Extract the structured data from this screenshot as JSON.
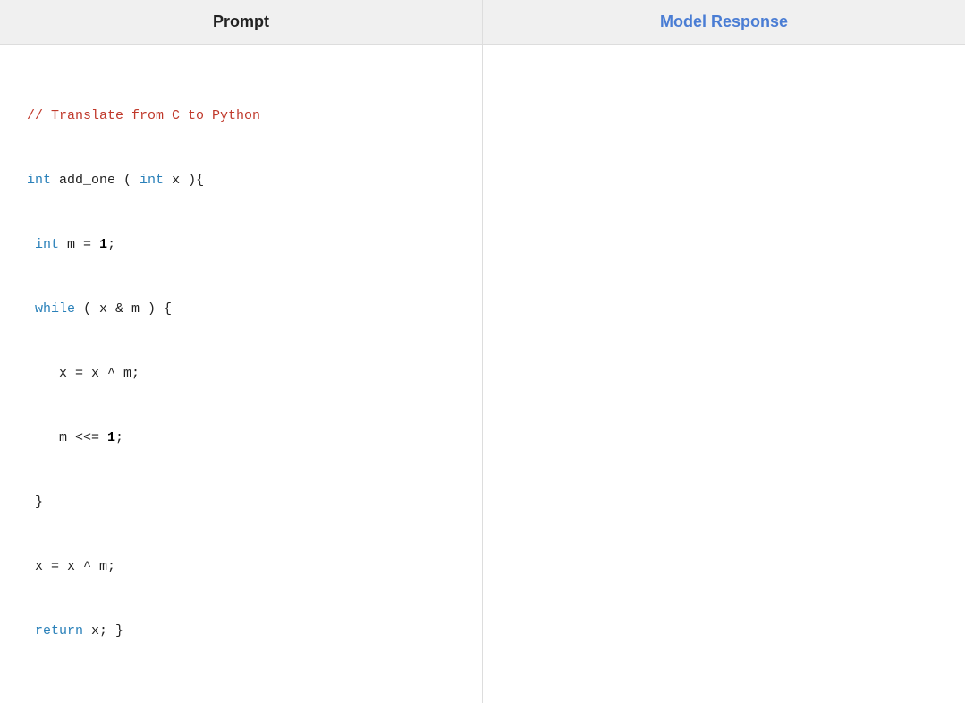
{
  "header": {
    "prompt_label": "Prompt",
    "model_response_label": "Model Response"
  },
  "prompt": {
    "code_lines": [
      {
        "type": "comment",
        "text": "// Translate from C to Python"
      },
      {
        "type": "mixed",
        "parts": [
          {
            "type": "keyword",
            "text": "int"
          },
          {
            "type": "plain",
            "text": " add_one ( "
          },
          {
            "type": "keyword",
            "text": "int"
          },
          {
            "type": "plain",
            "text": " x ){"
          }
        ]
      },
      {
        "type": "mixed",
        "parts": [
          {
            "type": "plain",
            "text": " "
          },
          {
            "type": "keyword",
            "text": "int"
          },
          {
            "type": "plain",
            "text": " m = "
          },
          {
            "type": "bold",
            "text": "1"
          },
          {
            "type": "plain",
            "text": ";"
          }
        ]
      },
      {
        "type": "mixed",
        "parts": [
          {
            "type": "plain",
            "text": " "
          },
          {
            "type": "keyword",
            "text": "while"
          },
          {
            "type": "plain",
            "text": " ( x & m ) {"
          }
        ]
      },
      {
        "type": "plain",
        "text": "    x = x ^ m;"
      },
      {
        "type": "mixed",
        "parts": [
          {
            "type": "plain",
            "text": "    m <<= "
          },
          {
            "type": "bold",
            "text": "1"
          },
          {
            "type": "plain",
            "text": ";"
          }
        ]
      },
      {
        "type": "plain",
        "text": " }"
      },
      {
        "type": "plain",
        "text": " x = x ^ m;"
      },
      {
        "type": "mixed",
        "parts": [
          {
            "type": "plain",
            "text": " "
          },
          {
            "type": "keyword",
            "text": "return"
          },
          {
            "type": "plain",
            "text": " x; }"
          }
        ]
      }
    ]
  },
  "colors": {
    "keyword": "#2980b9",
    "comment": "#c0392b",
    "plain": "#222222",
    "bold": "#000000",
    "header_bg": "#f0f0f0",
    "model_response_color": "#4a7dd4"
  }
}
